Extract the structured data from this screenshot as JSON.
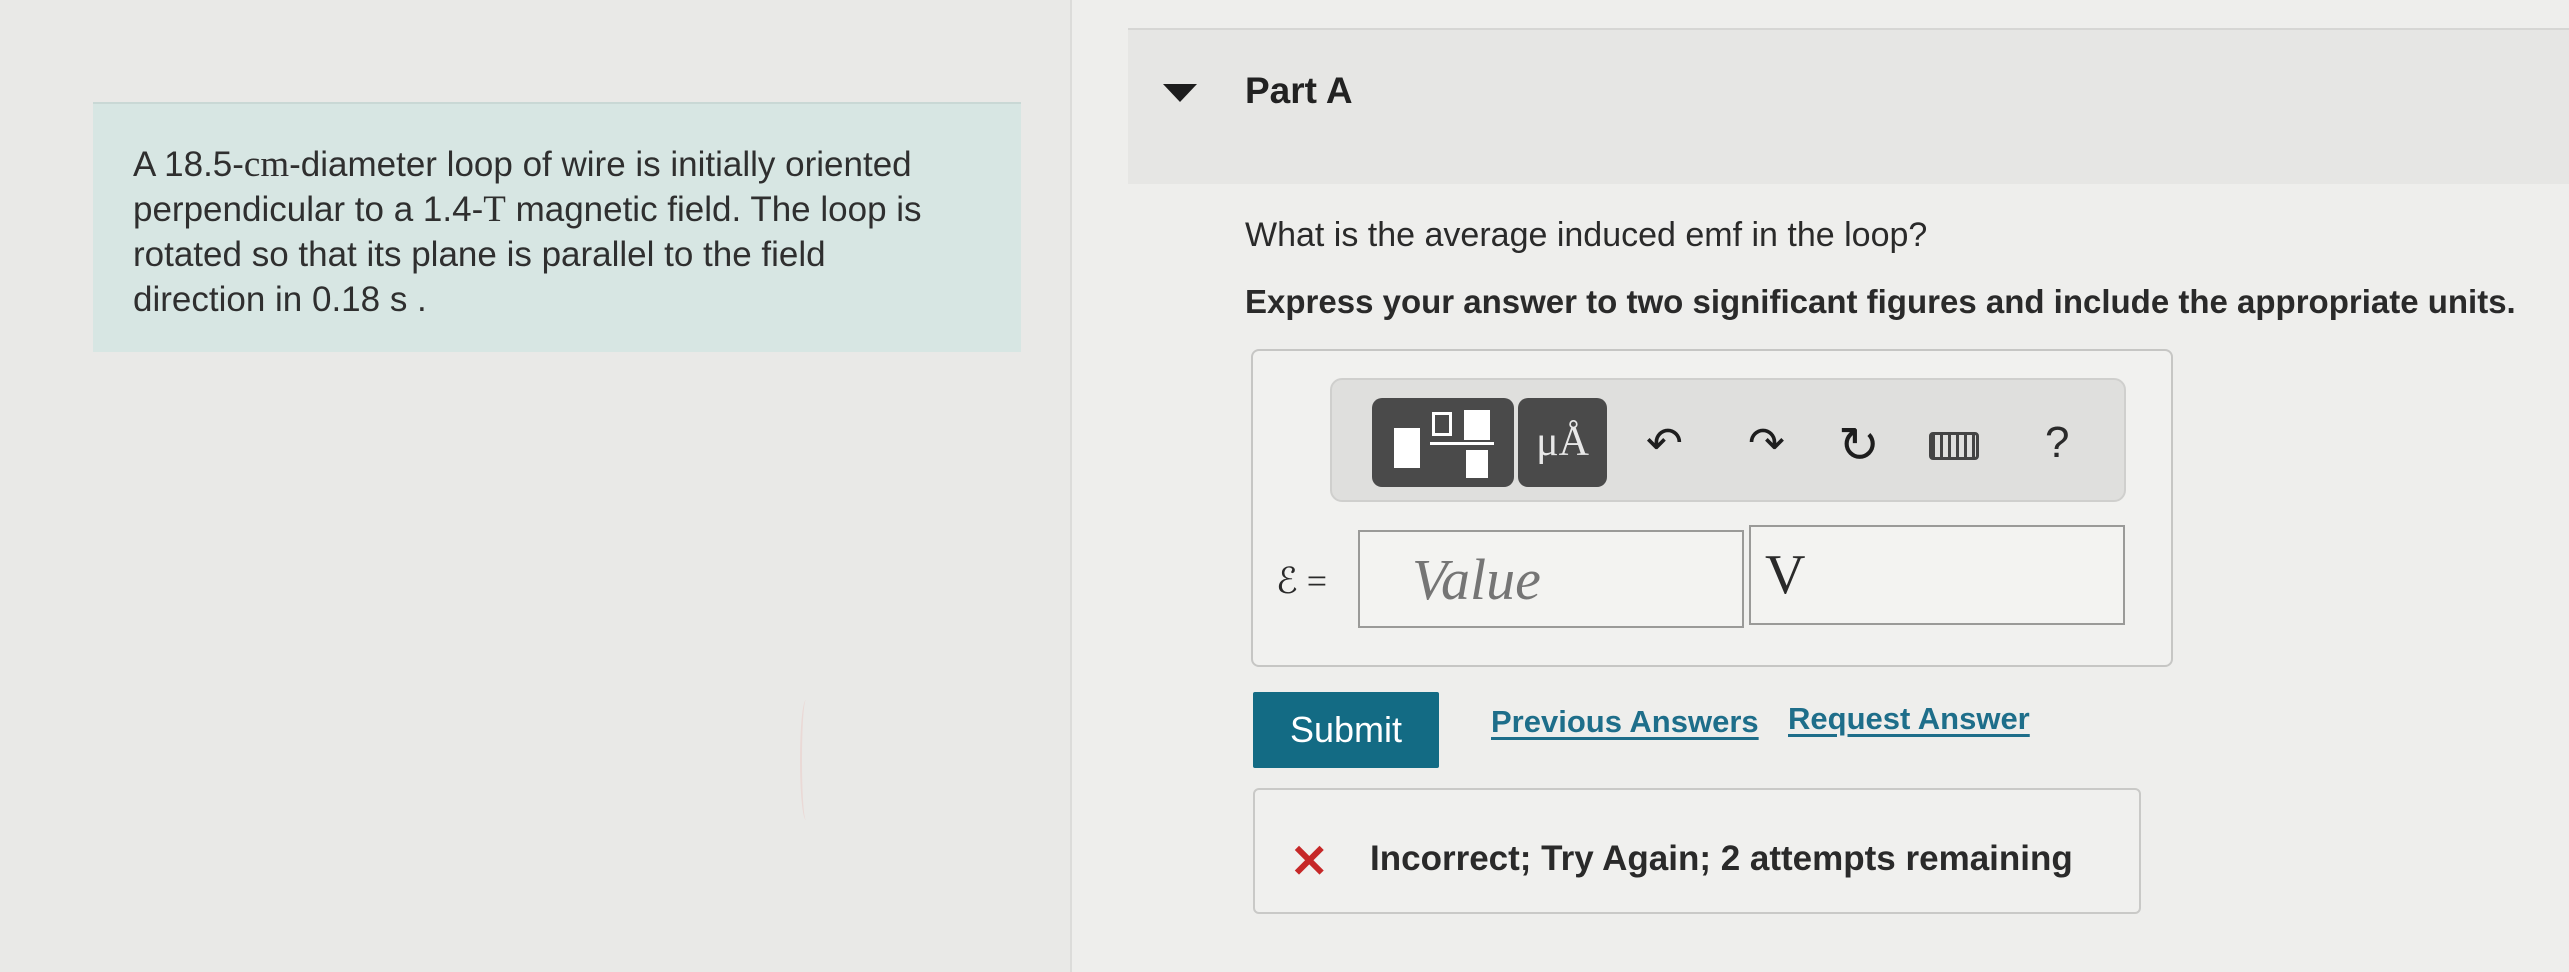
{
  "problem": {
    "line1_pre": "A 18.5-",
    "line1_unit": "cm",
    "line1_post": "-diameter loop of wire is initially oriented",
    "line2_pre": "perpendicular to a 1.4-",
    "line2_unit": "T",
    "line2_post": " magnetic field. The loop is",
    "line3": "rotated so that its plane is parallel to the field",
    "line4": "direction in 0.18  s ."
  },
  "part": {
    "title": "Part A",
    "question": "What is the average induced emf in the loop?",
    "instruction": "Express your answer to two significant figures and include the appropriate units."
  },
  "toolbar": {
    "units_label": "μÅ",
    "undo": "↶",
    "redo": "↷",
    "reset": "↻",
    "help": "?"
  },
  "answer": {
    "label": "ℰ =",
    "value_placeholder": "Value",
    "unit_value": "V"
  },
  "actions": {
    "submit": "Submit",
    "previous_answers": "Previous Answers",
    "request_answer": "Request Answer"
  },
  "feedback": {
    "icon": "✕",
    "message": "Incorrect; Try Again; 2 attempts remaining"
  },
  "colors": {
    "submit_bg": "#136b84",
    "link": "#1e6e8a",
    "error": "#c62828",
    "problem_bg": "#d7e6e3"
  }
}
